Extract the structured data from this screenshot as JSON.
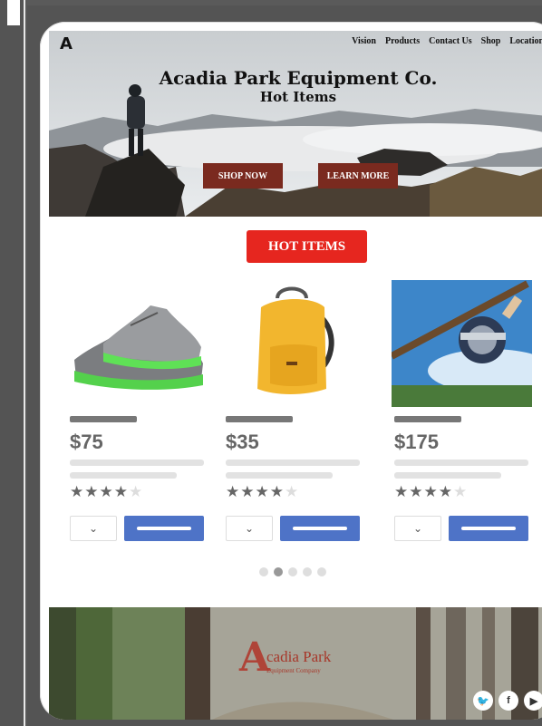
{
  "nav": {
    "logo": "A",
    "items": [
      "Vision",
      "Products",
      "Contact Us",
      "Shop",
      "Locations"
    ]
  },
  "hero": {
    "title": "Acadia Park Equipment Co.",
    "subtitle": "Hot Items",
    "shop_now": "SHOP NOW",
    "learn_more": "LEARN MORE"
  },
  "section": {
    "hot_items": "HOT ITEMS"
  },
  "products": [
    {
      "price": "$75",
      "image": "shoe",
      "rating": 4,
      "max_rating": 5
    },
    {
      "price": "$35",
      "image": "backpack",
      "rating": 4,
      "max_rating": 5
    },
    {
      "price": "$175",
      "image": "fishing-reel",
      "rating": 4,
      "max_rating": 5
    }
  ],
  "carousel": {
    "count": 5,
    "active_index": 1
  },
  "footer": {
    "brand_letter": "A",
    "brand_name": "cadia Park",
    "brand_sub": "Equipment Company",
    "social": [
      "twitter-icon",
      "facebook-icon",
      "youtube-icon"
    ],
    "social_glyphs": [
      "🐦",
      "f",
      "▶"
    ]
  },
  "colors": {
    "hero_button": "#7a2a1f",
    "hot_items": "#e6261f",
    "cart_button": "#4e73c7",
    "brand": "#b03a2e"
  }
}
